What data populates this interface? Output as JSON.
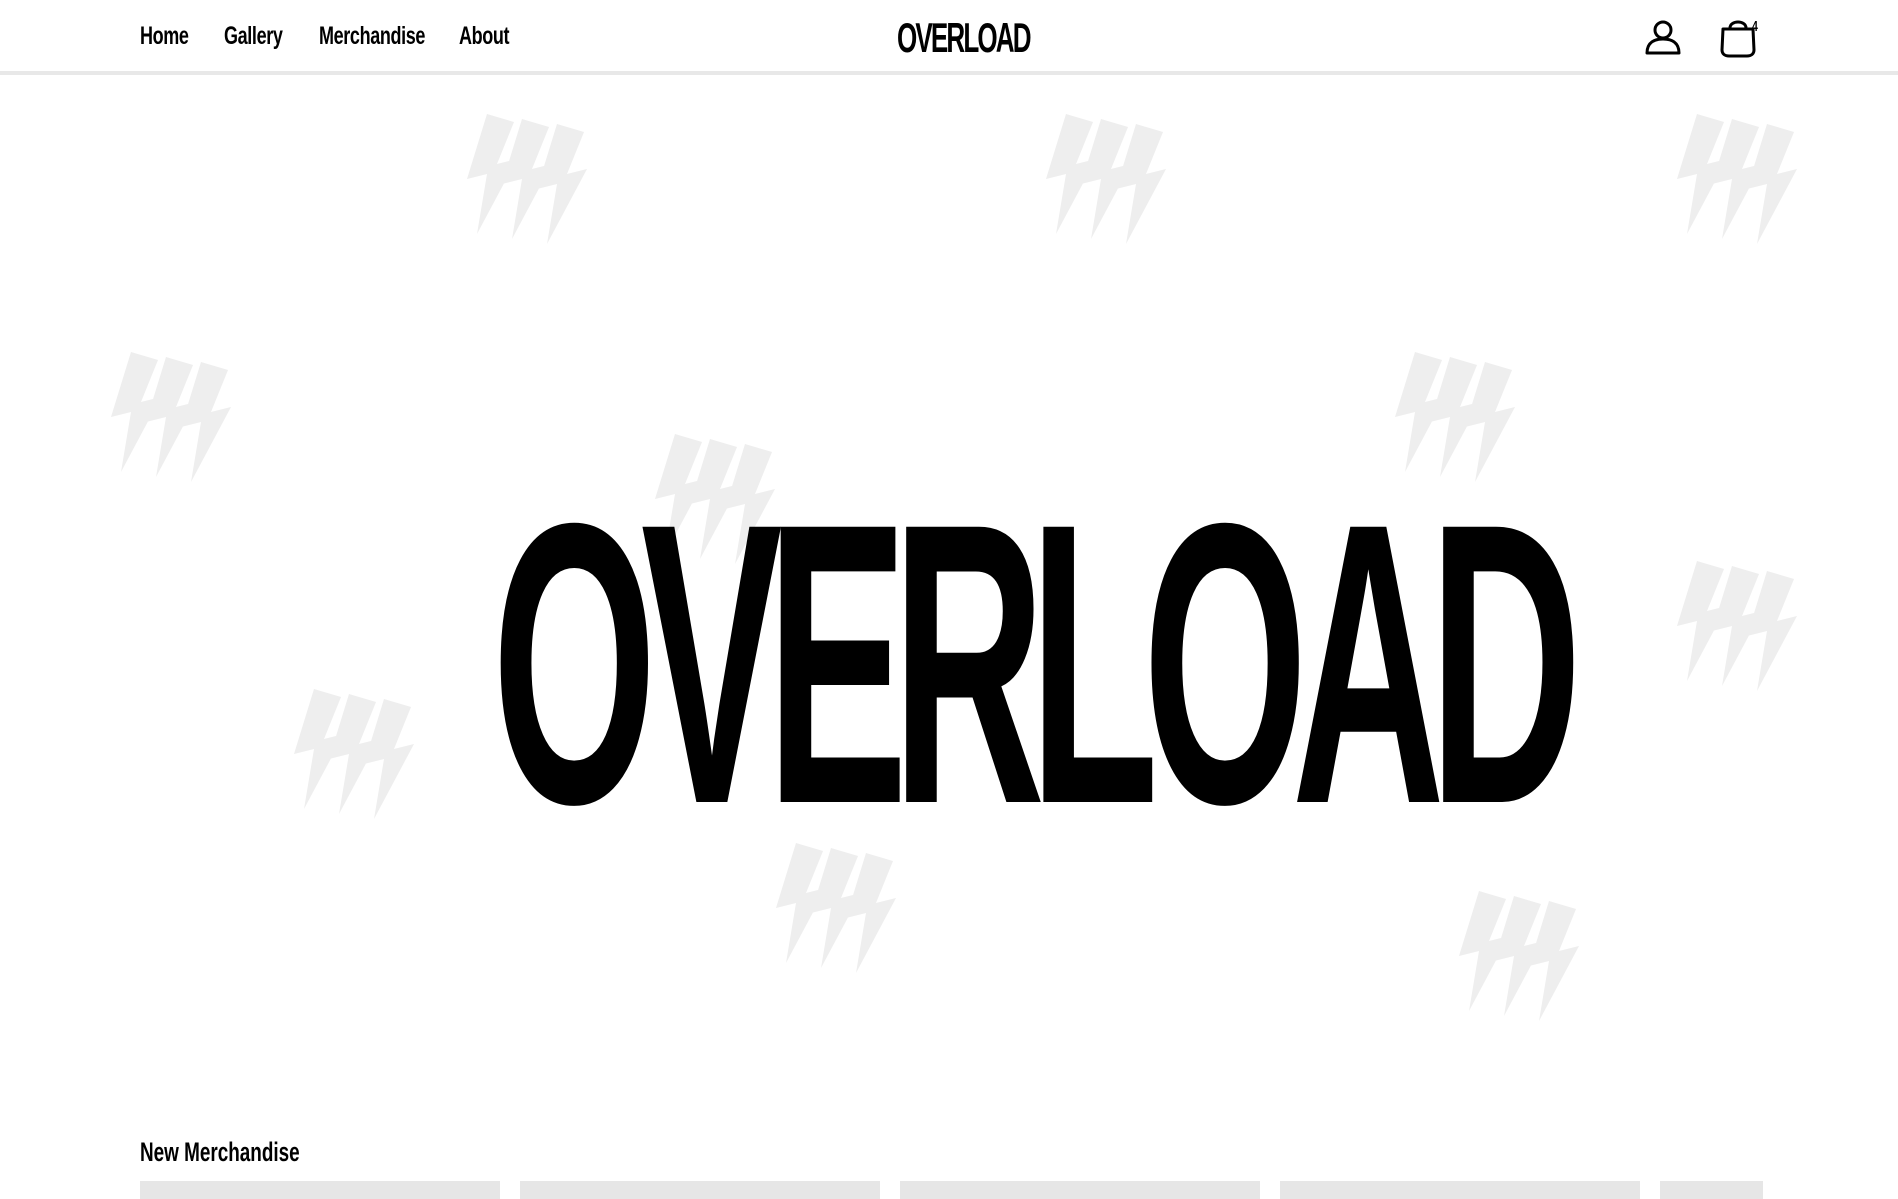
{
  "header": {
    "nav": [
      {
        "label": "Home"
      },
      {
        "label": "Gallery"
      },
      {
        "label": "Merchandise"
      },
      {
        "label": "About"
      }
    ],
    "logo": "OVERLOAD",
    "account_icon": "user-icon",
    "cart_icon": "shopping-bag-icon",
    "cart_count": "4"
  },
  "hero": {
    "title": "OVERLOAD",
    "background_icon": "lightning-bolt-icon",
    "bolt_color": "#eeeeee"
  },
  "merch": {
    "title": "New Merchandise",
    "card_color": "#e6e6e6"
  }
}
